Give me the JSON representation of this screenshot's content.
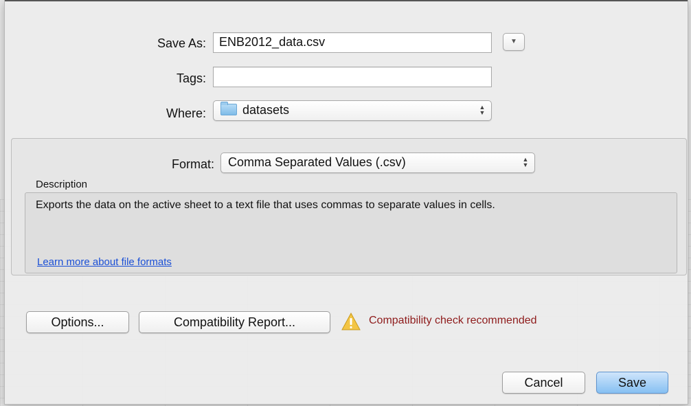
{
  "save_as": {
    "label": "Save As:",
    "value": "ENB2012_data.csv"
  },
  "tags": {
    "label": "Tags:",
    "value": ""
  },
  "where": {
    "label": "Where:",
    "value": "datasets",
    "icon": "folder-icon"
  },
  "format": {
    "label": "Format:",
    "value": "Comma Separated Values (.csv)"
  },
  "description": {
    "heading": "Description",
    "text": "Exports the data on the active sheet to a text file that uses commas to separate values in cells."
  },
  "learn_more": "Learn more about file formats",
  "buttons": {
    "options": "Options...",
    "compatibility_report": "Compatibility Report...",
    "cancel": "Cancel",
    "save": "Save"
  },
  "warning": {
    "icon": "warning-icon",
    "text": "Compatibility check recommended",
    "color": "#8e1b1b"
  },
  "colors": {
    "default_button": "#86c0f2",
    "link": "#1a4fd6"
  }
}
